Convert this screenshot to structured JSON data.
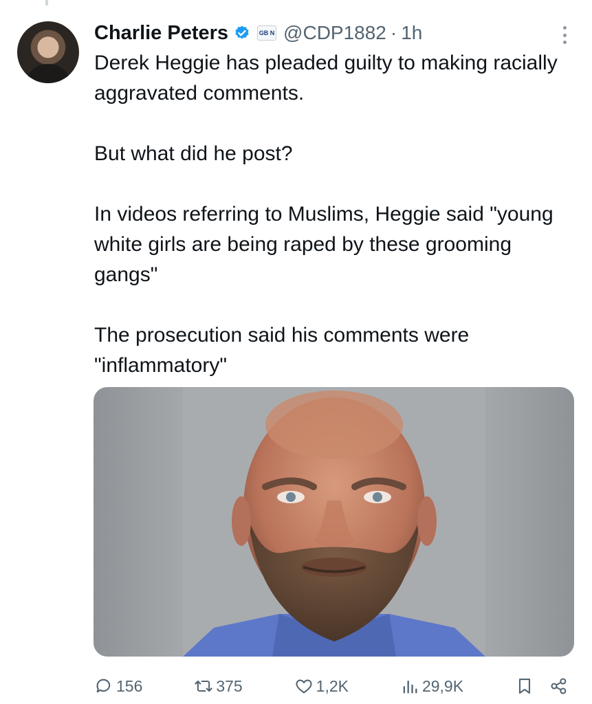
{
  "author": {
    "display_name": "Charlie Peters",
    "handle": "@CDP1882",
    "separator": "·",
    "time": "1h",
    "org_badge": "GB N"
  },
  "tweet": {
    "paragraphs": [
      "Derek Heggie has pleaded guilty to making racially aggravated comments.",
      "But what did he post?",
      "In videos referring to Muslims, Heggie said \"young white girls are being raped by these grooming gangs\"",
      "The prosecution said his comments were \"inflammatory\""
    ]
  },
  "actions": {
    "replies": "156",
    "reposts": "375",
    "likes": "1,2K",
    "views": "29,9K"
  },
  "colors": {
    "text": "#0f1419",
    "secondary": "#536471",
    "verified": "#1d9bf0"
  },
  "icons": [
    "verified-badge-icon",
    "more-icon",
    "reply-icon",
    "repost-icon",
    "like-icon",
    "views-icon",
    "bookmark-icon",
    "share-icon"
  ]
}
